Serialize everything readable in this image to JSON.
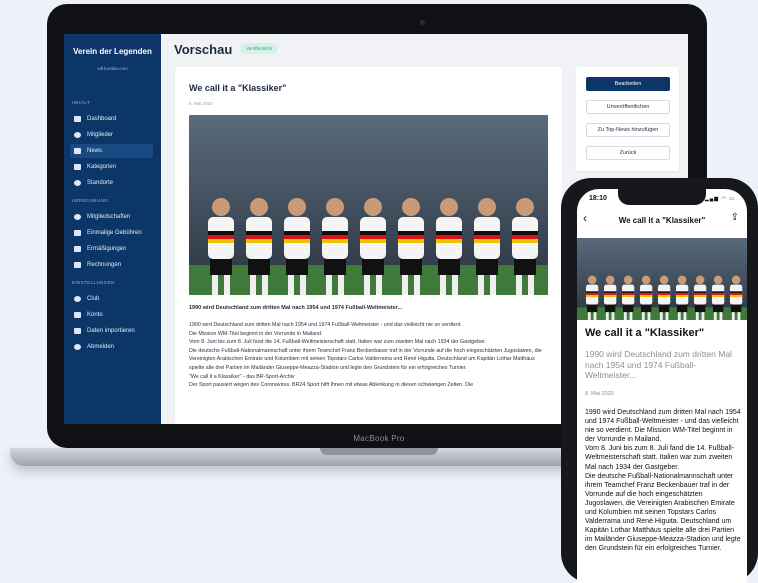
{
  "laptop": {
    "brand_label": "MacBook Pro"
  },
  "sidebar": {
    "title": "Verein der Legenden",
    "subtitle": "vdl.kurabu.com",
    "sections": [
      {
        "label": "INHALT",
        "items": [
          {
            "label": "Dashboard",
            "icon": "table-icon"
          },
          {
            "label": "Mitglieder",
            "icon": "users-icon"
          },
          {
            "label": "News",
            "icon": "news-icon",
            "active": true
          },
          {
            "label": "Kategorien",
            "icon": "tags-icon"
          },
          {
            "label": "Standorte",
            "icon": "location-pin-icon"
          }
        ]
      },
      {
        "label": "ABRECHNUNG",
        "items": [
          {
            "label": "Mitgliedschaften",
            "icon": "gear-icon"
          },
          {
            "label": "Einmalige Gebühren",
            "icon": "tag-icon"
          },
          {
            "label": "Ermäßigungen",
            "icon": "percent-icon"
          },
          {
            "label": "Rechnungen",
            "icon": "invoice-icon"
          }
        ]
      },
      {
        "label": "EINSTELLUNGEN",
        "items": [
          {
            "label": "Club",
            "icon": "gear-icon"
          },
          {
            "label": "Konto",
            "icon": "cart-icon"
          },
          {
            "label": "Daten importieren",
            "icon": "person-upload-icon"
          },
          {
            "label": "Abmelden",
            "icon": "power-icon"
          }
        ]
      }
    ]
  },
  "main": {
    "title": "Vorschau",
    "status_badge": "Veröffentlicht"
  },
  "article": {
    "title": "We call it a \"Klassiker\"",
    "date": "8. Mai 2020",
    "lead": "1990 wird Deutschland zum dritten Mal nach 1954 und 1974 Fußball-Weltmeister...",
    "body": [
      "1990 wird Deutschland zum dritten Mal nach 1954 und 1974 Fußball-Weltmeister - und das vielleicht nie so verdient.",
      "Die Mission WM-Titel beginnt in der Vorrunde in Mailand.",
      "Vom 8. Juni bis zum 8. Juli fand die 14. Fußball-Weltmeisterschaft statt. Italien war zum zweiten Mal nach 1934 der Gastgeber.",
      "Die deutsche Fußball-Nationalmannschaft unter ihrem Teamchef Franz Beckenbauer traf in der Vorrunde auf die hoch eingeschätzten Jugoslawen, die Vereinigten Arabischen Emirate und Kolumbien mit seinen Topstars Carlos Valderrama und René Higuita. Deutschland um Kapitän Lothar Matthäus spielte alle drei Partien im Mailänder Giuseppe-Meazza-Stadion und legte den Grundstein für ein erfolgreiches Turnier.",
      "\"We call it a Klassiker\" - das BR-Sport-Archiv",
      "Der Sport pausiert wegen des Coronavirus. BR24 Sport hilft Ihnen mit etwas Ablenkung in diesen schwierigen Zeiten. Die"
    ]
  },
  "actions": {
    "edit": "Bearbeiten",
    "unpublish": "Unveröffentlichen",
    "top_news": "Zu Top-News hinzufügen",
    "back": "Zurück"
  },
  "phone": {
    "time": "18:10",
    "status_icons": "▂▄▆ ◠ ▭",
    "nav_title": "We call it a \"Klassiker\"",
    "back_icon": "‹",
    "share_icon": "⇪",
    "title": "We call it a \"Klassiker\"",
    "subtitle": "1990 wird Deutschland zum dritten Mal nach 1954 und 1974 Fußball-Weltmeister...",
    "date": "8. Mai 2020",
    "body": [
      "1990 wird Deutschland zum dritten Mal nach 1954 und 1974 Fußball-Weltmeister - und das vielleicht nie so verdient. Die Mission WM-Titel beginnt in der Vorrunde in Mailand.",
      "Vom 8. Juni bis zum 8. Juli fand die 14. Fußball-Weltmeisterschaft statt. Italien war zum zweiten Mal nach 1934 der Gastgeber.",
      "Die deutsche Fußball-Nationalmannschaft unter ihrem Teamchef Franz Beckenbauer traf in der Vorrunde auf die hoch eingeschätzten Jugoslawen, die Vereinigten Arabischen Emirate und Kolumbien mit seinen Topstars Carlos Valderrama und René Higuita. Deutschland um Kapitän Lothar Matthäus spielte alle drei Partien im Mailänder Giuseppe-Meazza-Stadion und legte den Grundstein für ein erfolgreiches Turnier."
    ]
  },
  "colors": {
    "sidebar": "#0c3668",
    "accent": "#0c3668",
    "badge_bg": "#d6f1e6",
    "badge_text": "#3aa37c"
  }
}
